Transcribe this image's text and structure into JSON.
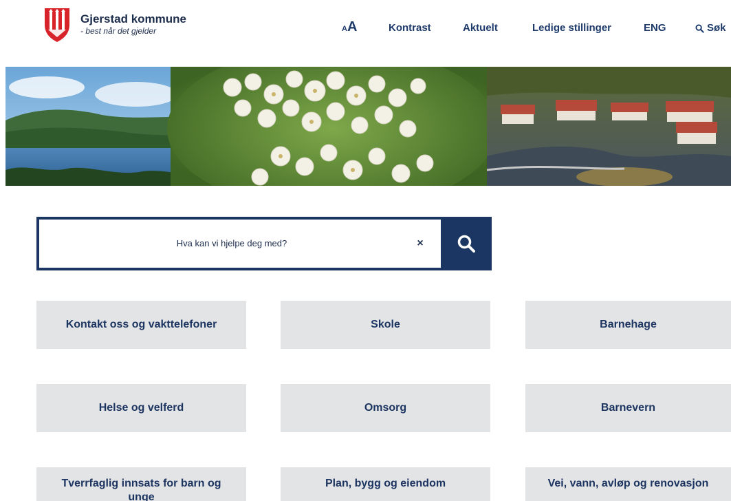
{
  "header": {
    "brand_name": "Gjerstad kommune",
    "brand_tagline": "- best når det gjelder",
    "nav": {
      "text_size_small": "A",
      "text_size_big": "A",
      "contrast": "Kontrast",
      "news": "Aktuelt",
      "jobs": "Ledige stillinger",
      "language": "ENG",
      "search": "Søk"
    }
  },
  "search": {
    "placeholder": "Hva kan vi hjelpe deg med?",
    "clear_label": "×"
  },
  "tiles": [
    {
      "label": "Kontakt oss og vakttelefoner"
    },
    {
      "label": "Skole"
    },
    {
      "label": "Barnehage"
    },
    {
      "label": "Helse og velferd"
    },
    {
      "label": "Omsorg"
    },
    {
      "label": "Barnevern"
    },
    {
      "label": "Tverrfaglig innsats for barn og unge"
    },
    {
      "label": "Plan, bygg og eiendom"
    },
    {
      "label": "Vei, vann, avløp og renovasjon"
    }
  ],
  "icons": {
    "logo": "coat-of-arms-icon",
    "search_nav": "search-icon",
    "search_button": "search-icon",
    "clear": "close-icon"
  },
  "colors": {
    "primary": "#1b3663",
    "tile_bg": "#e3e4e6",
    "logo_red": "#d8232a"
  }
}
